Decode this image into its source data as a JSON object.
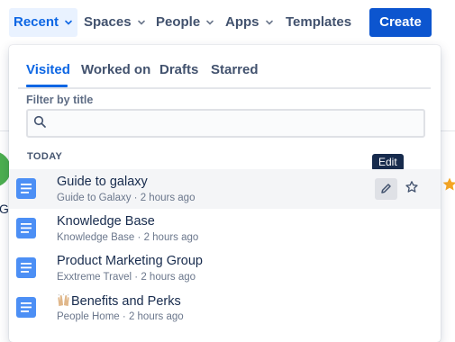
{
  "nav": {
    "items": [
      {
        "label": "Recent",
        "active": true
      },
      {
        "label": "Spaces"
      },
      {
        "label": "People"
      },
      {
        "label": "Apps"
      },
      {
        "label": "Templates"
      }
    ],
    "create_label": "Create"
  },
  "background": {
    "partial_text": "Gu"
  },
  "dropdown": {
    "tabs": [
      {
        "label": "Visited",
        "active": true
      },
      {
        "label": "Worked on"
      },
      {
        "label": "Drafts"
      },
      {
        "label": "Starred"
      }
    ],
    "filter": {
      "label": "Filter by title",
      "value": "",
      "placeholder": ""
    },
    "section_heading": "TODAY",
    "tooltip": "Edit",
    "items": [
      {
        "title": "Guide to galaxy",
        "space": "Guide to Galaxy",
        "time": "2 hours ago"
      },
      {
        "title": "Knowledge Base",
        "space": "Knowledge Base",
        "time": "2 hours ago"
      },
      {
        "title": "Product Marketing Group",
        "space": "Exxtreme Travel",
        "time": "2 hours ago"
      },
      {
        "title": "Benefits and Perks",
        "space": "People Home",
        "time": "2 hours ago"
      }
    ],
    "separator": "·"
  },
  "colors": {
    "accent": "#0c66e4",
    "create_button": "#0c55cf",
    "page_icon": "#4c8ff5",
    "tooltip_bg": "#172b4d",
    "star_background": "#f5a623"
  },
  "icons": {
    "nav_chevron": "chevron-down-icon",
    "search": "search-icon",
    "page": "page-icon",
    "edit": "pencil-icon",
    "star": "star-icon",
    "emoji": "raising-hands-emoji"
  }
}
